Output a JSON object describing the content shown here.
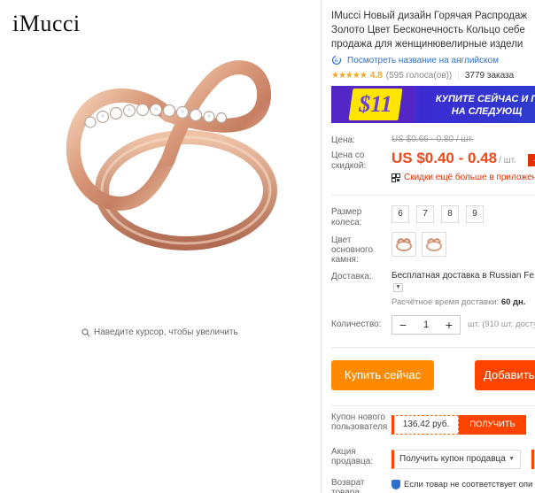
{
  "brand": "iMucci",
  "gallery": {
    "zoom_hint": "Наведите курсор, чтобы увеличить"
  },
  "product": {
    "title_lines": [
      "IMucci Новый дизайн Горячая Распродаж",
      "Золото Цвет Бесконечность Кольцо себе",
      "продажа для женщинювелирные издели"
    ],
    "translate_link": "Посмотреть название на английском",
    "rating": {
      "stars": "★★★★★",
      "value": "4.8",
      "votes": "(595 голоса(ов))",
      "orders": "3779 заказа"
    },
    "promo_banner": {
      "price": "$11",
      "text_line1": "КУПИТЕ СЕЙЧАС И П",
      "text_line2": "НА СЛЕДУЮЩ"
    },
    "price": {
      "label": "Цена:",
      "old": "US $0.66 - 0.80 / шт.",
      "discount_label": "Цена со скидкой:",
      "new": "US $0.40 - 0.48",
      "unit": "/ шт.",
      "badge": "-",
      "app_promo": "Скидки ещё больше в приложен"
    },
    "size": {
      "label": "Размер колеса:",
      "options": [
        "6",
        "7",
        "8",
        "9"
      ]
    },
    "stone": {
      "label": "Цвет основного камня:"
    },
    "shipping": {
      "label": "Доставка:",
      "main": "Бесплатная доставка в Russian Fe",
      "time_label": "Расчётное время доставки:",
      "time_value": "60 дн."
    },
    "quantity": {
      "label": "Количество:",
      "minus": "−",
      "value": "1",
      "plus": "+",
      "info": "шт. (910 шт. доступ"
    },
    "buttons": {
      "buy": "Купить сейчас",
      "cart": "Добавить"
    },
    "coupon": {
      "label": "Купон нового пользователя",
      "amount": "136,42 руб.",
      "button": "ПОЛУЧИТЬ"
    },
    "seller_promo": {
      "label": "Акция продавца:",
      "select": "Получить купон продавца",
      "arrow": "▼"
    },
    "returns": {
      "label": "Возврат товара",
      "text": "Если товар не соответствует опи"
    }
  },
  "colors": {
    "accent_orange": "#ff8a00",
    "accent_red": "#ff4400",
    "price_red": "#f04a1b",
    "link_blue": "#2e6fcb",
    "star_yellow": "#f5a623",
    "promo_purple": "#4f29c7",
    "promo_yellow": "#ffe600"
  }
}
